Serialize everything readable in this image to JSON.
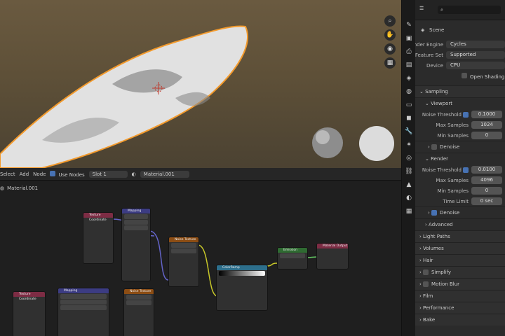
{
  "viewport": {
    "nav_gizmo": [
      "zoom-icon",
      "hand-icon",
      "camera-icon",
      "grid-icon"
    ]
  },
  "node_editor": {
    "header": {
      "select": "Select",
      "add": "Add",
      "node": "Node",
      "use_nodes": "Use Nodes",
      "slot": "Slot 1",
      "material": "Material.001"
    },
    "breadcrumb": "Material.001"
  },
  "properties": {
    "scene_label": "Scene",
    "render_engine_label": "Render Engine",
    "render_engine": "Cycles",
    "feature_set_label": "Feature Set",
    "feature_set": "Supported",
    "device_label": "Device",
    "device": "CPU",
    "osl_label": "Open Shading La",
    "sampling": "Sampling",
    "viewport": "Viewport",
    "noise_threshold_label": "Noise Threshold",
    "vp_noise_threshold": "0.1000",
    "max_samples_label": "Max Samples",
    "vp_max_samples": "1024",
    "min_samples_label": "Min Samples",
    "vp_min_samples": "0",
    "denoise": "Denoise",
    "render": "Render",
    "r_noise_threshold": "0.0100",
    "r_max_samples": "4096",
    "r_min_samples": "0",
    "time_limit_label": "Time Limit",
    "r_time_limit": "0 sec",
    "advanced": "Advanced",
    "light_paths": "Light Paths",
    "volumes": "Volumes",
    "hair": "Hair",
    "simplify": "Simplify",
    "motion_blur": "Motion Blur",
    "film": "Film",
    "performance": "Performance",
    "bake": "Bake"
  }
}
